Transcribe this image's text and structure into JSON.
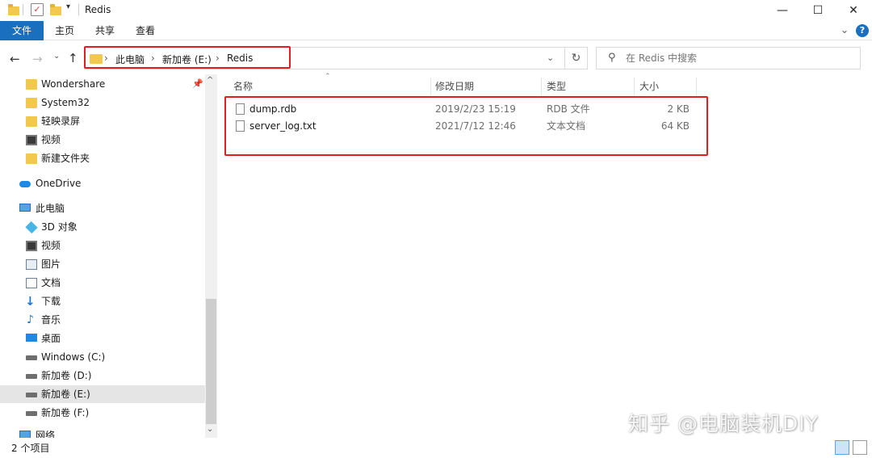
{
  "window": {
    "title": "Redis",
    "minimize_glyph": "—",
    "maximize_glyph": "☐",
    "close_glyph": "✕"
  },
  "ribbon": {
    "tabs": [
      {
        "label": "文件"
      },
      {
        "label": "主页"
      },
      {
        "label": "共享"
      },
      {
        "label": "查看"
      }
    ],
    "help_glyph": "?",
    "expand_glyph": "⌄"
  },
  "address": {
    "breadcrumbs": [
      "此电脑",
      "新加卷 (E:)",
      "Redis"
    ],
    "separator": "›"
  },
  "search": {
    "placeholder": "在 Redis 中搜索"
  },
  "sidebar": {
    "items": [
      {
        "label": "Wondershare",
        "icon": "folder-icon"
      },
      {
        "label": "System32",
        "icon": "folder-icon"
      },
      {
        "label": "轻映录屏",
        "icon": "folder-icon"
      },
      {
        "label": "视频",
        "icon": "video-icon"
      },
      {
        "label": "新建文件夹",
        "icon": "folder-icon"
      },
      {
        "label": "OneDrive",
        "icon": "cloud-icon"
      },
      {
        "label": "此电脑",
        "icon": "pc-icon"
      },
      {
        "label": "3D 对象",
        "icon": "cube-icon"
      },
      {
        "label": "视频",
        "icon": "video-icon"
      },
      {
        "label": "图片",
        "icon": "picture-icon"
      },
      {
        "label": "文档",
        "icon": "document-icon"
      },
      {
        "label": "下载",
        "icon": "download-icon"
      },
      {
        "label": "音乐",
        "icon": "music-icon"
      },
      {
        "label": "桌面",
        "icon": "desktop-icon"
      },
      {
        "label": "Windows (C:)",
        "icon": "windows-drive-icon"
      },
      {
        "label": "新加卷 (D:)",
        "icon": "drive-icon"
      },
      {
        "label": "新加卷 (E:)",
        "icon": "drive-icon"
      },
      {
        "label": "新加卷 (F:)",
        "icon": "drive-icon"
      },
      {
        "label": "网络",
        "icon": "network-icon"
      }
    ]
  },
  "columns": {
    "name": "名称",
    "modified": "修改日期",
    "type": "类型",
    "size": "大小"
  },
  "files": [
    {
      "name": "dump.rdb",
      "modified": "2019/2/23 15:19",
      "type": "RDB 文件",
      "size": "2 KB"
    },
    {
      "name": "server_log.txt",
      "modified": "2021/7/12 12:46",
      "type": "文本文档",
      "size": "64 KB"
    }
  ],
  "status": {
    "item_count": "2 个项目"
  },
  "watermark": "知乎 @电脑装机DIY",
  "colors": {
    "accent": "#1a6fbf",
    "highlight": "#e02020",
    "selected": "#e5e5e5"
  }
}
